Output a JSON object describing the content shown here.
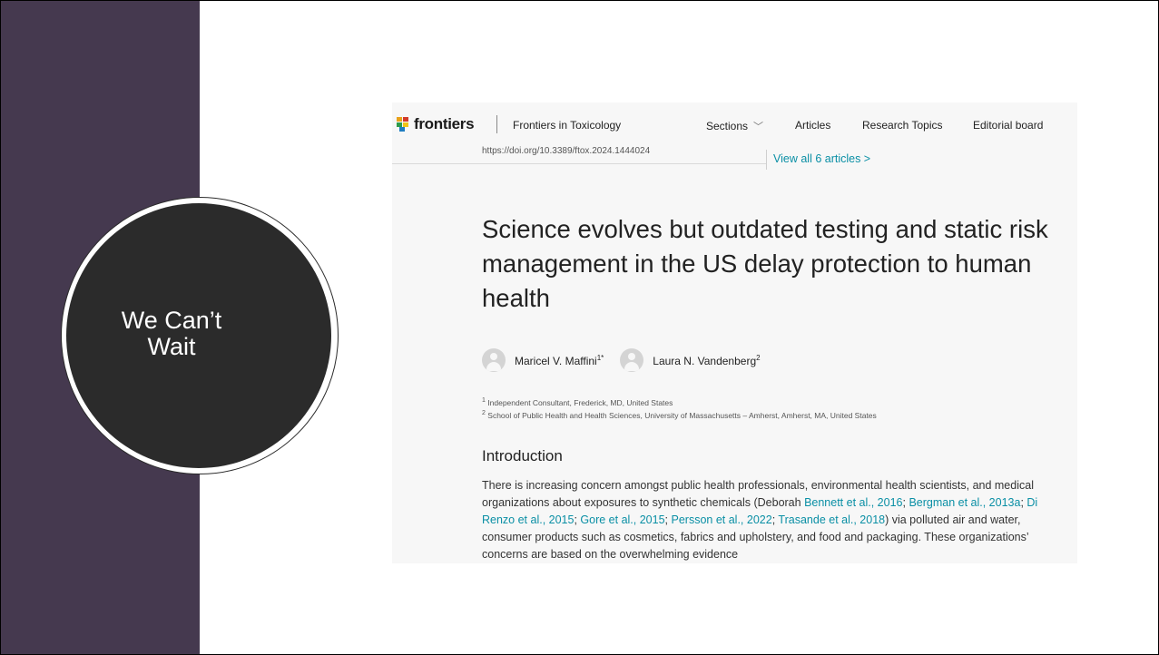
{
  "slide": {
    "circle_text": "We Can’t\nWait"
  },
  "screenshot": {
    "nav": {
      "logo_text": "frontiers",
      "journal": "Frontiers in Toxicology",
      "items": [
        "Sections",
        "Articles",
        "Research Topics",
        "Editorial board"
      ]
    },
    "doi": "https://doi.org/10.3389/ftox.2024.1444024",
    "view_all": "View all 6 articles  >",
    "title": "Science evolves but outdated testing and static risk management in the US delay protection to human health",
    "authors": [
      {
        "name": "Maricel V. Maffini",
        "sup": "1*"
      },
      {
        "name": "Laura N. Vandenberg",
        "sup": "2"
      }
    ],
    "affiliations": [
      {
        "num": "1",
        "text": "Independent Consultant, Frederick, MD, United States"
      },
      {
        "num": "2",
        "text": "School of Public Health and Health Sciences, University of Massachusetts – Amherst, Amherst, MA, United States"
      }
    ],
    "intro_heading": "Introduction",
    "intro": {
      "t1": "There is increasing concern amongst public health professionals, environmental health scientists, and medical organizations about exposures to synthetic chemicals (Deborah ",
      "r1": "Bennett et al., 2016",
      "s1": "; ",
      "r2": "Bergman et al., 2013a",
      "s2": "; ",
      "r3": "Di Renzo et al., 2015",
      "s3": "; ",
      "r4": "Gore et al., 2015",
      "s4": "; ",
      "r5": "Persson et al., 2022",
      "s5": "; ",
      "r6": "Trasande et al., 2018",
      "t2": ") via polluted air and water, consumer products such as cosmetics, fabrics and upholstery, and food and packaging. These organizations’ concerns are based on the overwhelming evidence"
    }
  },
  "colors": {
    "sidebar": "#45394f",
    "circle": "#2b2b2b",
    "link": "#0a8fa5"
  }
}
